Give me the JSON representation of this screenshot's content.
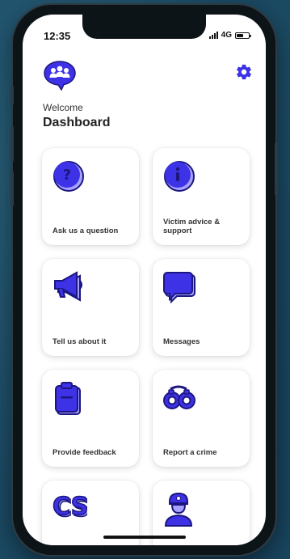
{
  "status": {
    "time": "12:35",
    "network": "4G"
  },
  "header": {
    "welcome": "Welcome",
    "title": "Dashboard"
  },
  "cards": [
    {
      "label": "Ask us a question",
      "icon": "question-icon"
    },
    {
      "label": "Victim advice & support",
      "icon": "info-icon"
    },
    {
      "label": "Tell us about it",
      "icon": "megaphone-icon"
    },
    {
      "label": "Messages",
      "icon": "message-icon"
    },
    {
      "label": "Provide feedback",
      "icon": "clipboard-icon"
    },
    {
      "label": "Report a crime",
      "icon": "handcuffs-icon"
    },
    {
      "label": "",
      "icon": "cs-icon"
    },
    {
      "label": "",
      "icon": "police-officer-icon"
    }
  ],
  "colors": {
    "accent": "#3d32e6",
    "accent_light": "#a7a2ff",
    "outline": "#1c1780"
  }
}
